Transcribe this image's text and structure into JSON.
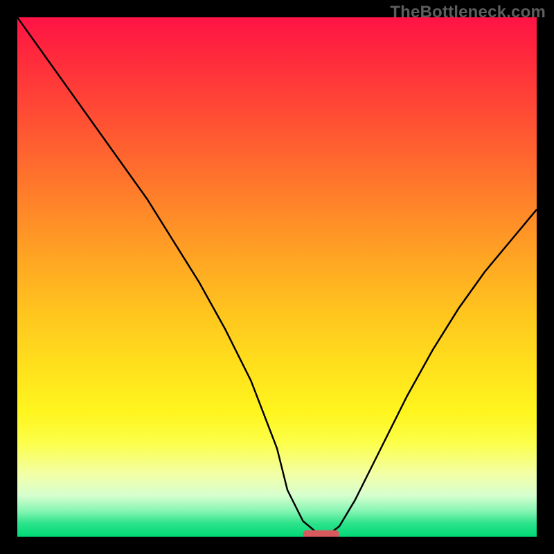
{
  "watermark": "TheBottleneck.com",
  "chart_data": {
    "type": "line",
    "title": "",
    "xlabel": "",
    "ylabel": "",
    "xlim": [
      0,
      100
    ],
    "ylim": [
      0,
      100
    ],
    "x": [
      0,
      5,
      10,
      15,
      20,
      25,
      30,
      35,
      40,
      45,
      50,
      52,
      55,
      58,
      60,
      62,
      65,
      70,
      75,
      80,
      85,
      90,
      95,
      100
    ],
    "values": [
      100,
      93,
      86,
      79,
      72,
      65,
      57,
      49,
      40,
      30,
      17,
      9,
      3,
      0.5,
      0.5,
      2,
      7,
      17,
      27,
      36,
      44,
      51,
      57,
      63
    ],
    "marker": {
      "x_center": 58.5,
      "y": 0.5,
      "width": 7,
      "height": 1.5
    },
    "gradient_stops": [
      {
        "pos": 0,
        "color": "#ff1345"
      },
      {
        "pos": 50,
        "color": "#ffaa22"
      },
      {
        "pos": 80,
        "color": "#fff51e"
      },
      {
        "pos": 100,
        "color": "#00d977"
      }
    ]
  }
}
